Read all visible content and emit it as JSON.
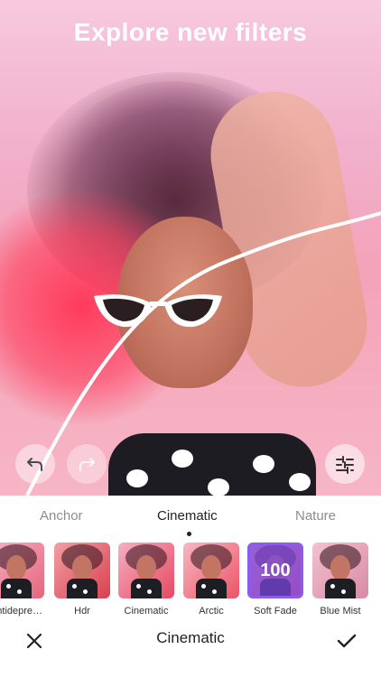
{
  "header": {
    "title": "Explore new filters"
  },
  "tabs": [
    {
      "label": "Anchor",
      "active": false
    },
    {
      "label": "Cinematic",
      "active": true
    },
    {
      "label": "Nature",
      "active": false
    }
  ],
  "filters": [
    {
      "label": "Antidepre…",
      "selected": false
    },
    {
      "label": "Hdr",
      "selected": false
    },
    {
      "label": "Cinematic",
      "selected": false
    },
    {
      "label": "Arctic",
      "selected": false
    },
    {
      "label": "Soft Fade",
      "selected": true,
      "value": "100"
    },
    {
      "label": "Blue Mist",
      "selected": false
    }
  ],
  "bottom": {
    "current_filter": "Cinematic"
  },
  "icons": {
    "undo": "undo-arrow-icon",
    "redo": "redo-arrow-icon",
    "adjust": "sliders-icon",
    "cancel": "close-icon",
    "confirm": "checkmark-icon"
  },
  "colors": {
    "accent": "#8c5cf0",
    "text_inactive": "#8b8b94"
  }
}
